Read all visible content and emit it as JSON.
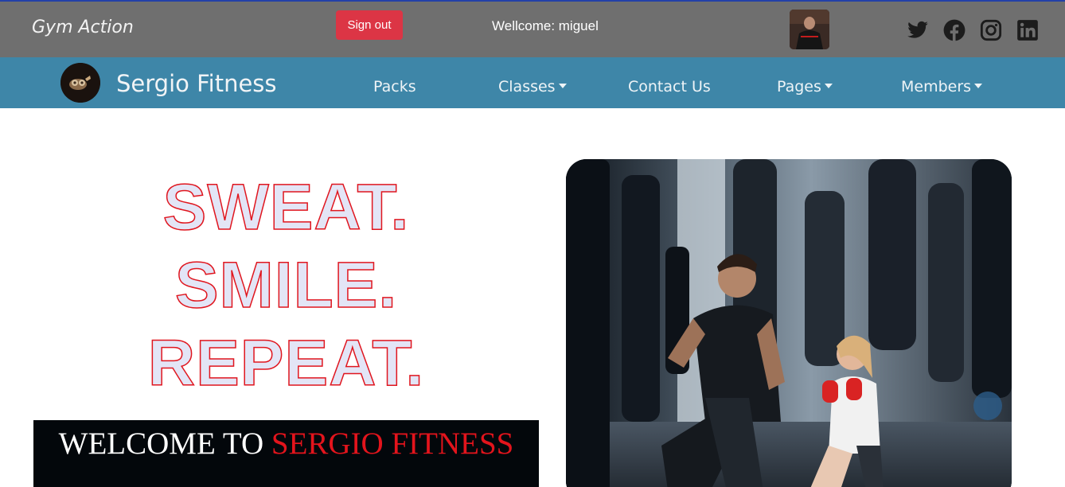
{
  "topbar": {
    "brand": "Gym Action",
    "signout_label": "Sign out",
    "welcome_text": "Wellcome: miguel",
    "avatar_icon": "user-avatar",
    "social": [
      "twitter-icon",
      "facebook-icon",
      "instagram-icon",
      "linkedin-icon"
    ],
    "colors": {
      "bar": "#6f6f6f",
      "signout": "#dc3545"
    }
  },
  "navbar": {
    "logo_icon": "gym-logo",
    "brand": "Sergio Fitness",
    "items": [
      {
        "label": "Packs",
        "dropdown": false
      },
      {
        "label": "Classes",
        "dropdown": true
      },
      {
        "label": "Contact Us",
        "dropdown": false
      },
      {
        "label": "Pages",
        "dropdown": true
      },
      {
        "label": "Members",
        "dropdown": true
      }
    ],
    "colors": {
      "bar": "#3e86a8"
    }
  },
  "hero": {
    "line1": "SWEAT.",
    "line2": "SMILE.",
    "line3": "REPEAT.",
    "welcome_white": "WELCOME TO",
    "welcome_red": "SERGIO FITNESS",
    "colors": {
      "stroke": "#e0161f",
      "fill": "#e3e5f6",
      "box": "#03070b"
    }
  }
}
